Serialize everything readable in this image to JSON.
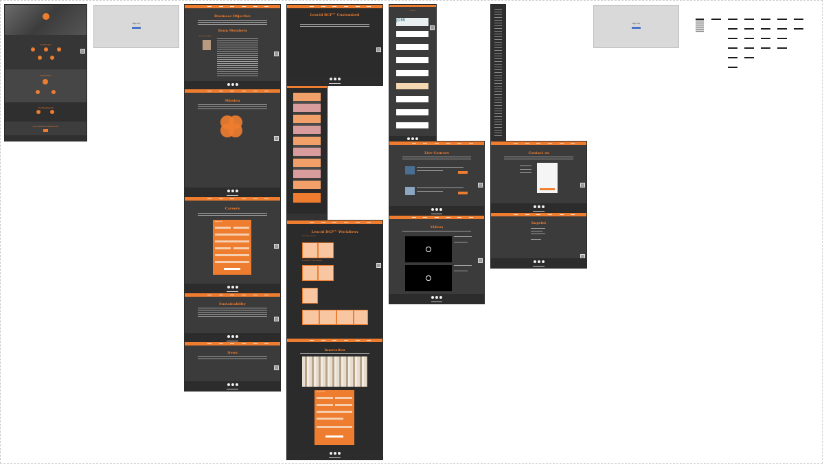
{
  "pages": {
    "home": {
      "sections": [
        "Leistungen",
        "Menschen",
        "Nachhaltigkeit",
        "Innovation & Wachstum"
      ]
    },
    "signup_left": {
      "label": "Sign Up"
    },
    "signup_right": {
      "label": "Sign Up"
    },
    "business": {
      "title": "Business Objective",
      "subtitle": "Team Members",
      "person": "Dr. Marcus Müller"
    },
    "mission": {
      "title": "Mission"
    },
    "careers": {
      "title": "Careers",
      "form_title": "Apply now"
    },
    "sustainability": {
      "title": "Sustainability"
    },
    "news": {
      "title": "News"
    },
    "customized": {
      "title": "Leucid BCP™ Customized"
    },
    "workflows": {
      "title": "Leucid BCP™ Workflows",
      "items": [
        "Instructions for Use",
        "Leucid BCP™ Drill Protocols"
      ]
    },
    "innovation": {
      "title": "Innovation",
      "form_title": "Registration"
    },
    "partners": {
      "title": "Partners",
      "logos": [
        "JOMI"
      ]
    },
    "live_courses": {
      "title": "Live Courses"
    },
    "videos": {
      "title": "Videos"
    },
    "contact": {
      "title": "Contact us"
    },
    "imprint": {
      "title": "Imprint"
    }
  },
  "colors": {
    "accent": "#ef7d2f",
    "panel": "#3b3b3b",
    "canvas": "#ffffff"
  }
}
